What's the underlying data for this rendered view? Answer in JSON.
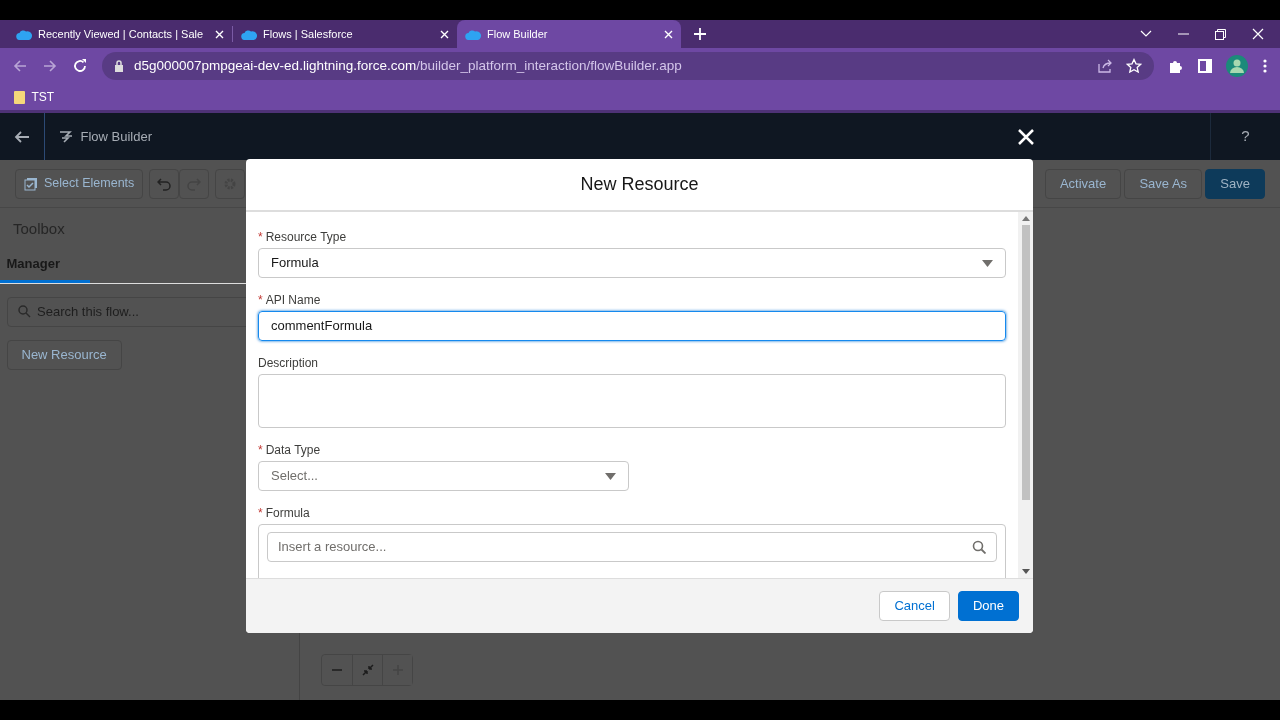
{
  "browser": {
    "tabs": [
      {
        "title": "Recently Viewed | Contacts | Sale",
        "selected": false
      },
      {
        "title": "Flows | Salesforce",
        "selected": false
      },
      {
        "title": "Flow Builder",
        "selected": true
      }
    ],
    "url_host": "d5g000007pmpgeai-dev-ed.lightning.force.com",
    "url_path": "/builder_platform_interaction/flowBuilder.app",
    "bookmarks": [
      {
        "label": "TST"
      }
    ]
  },
  "app": {
    "title": "Flow Builder",
    "help": "?"
  },
  "toolbar": {
    "select_elements": "Select Elements",
    "right_buttons": [
      {
        "label": "Activate",
        "kind": "neutral"
      },
      {
        "label": "Save As",
        "kind": "neutral"
      },
      {
        "label": "Save",
        "kind": "brand"
      }
    ]
  },
  "sidebar": {
    "title": "Toolbox",
    "tabs": [
      {
        "label": "Manager",
        "selected": true
      }
    ],
    "search": {
      "placeholder": "Search this flow..."
    },
    "button": "New Resource"
  },
  "modal": {
    "title": "New Resource",
    "required_mark": "*",
    "fields": [
      {
        "kind": "select",
        "label": "Resource Type",
        "required": true,
        "value": "Formula",
        "focused": false
      },
      {
        "kind": "input",
        "label": "API Name",
        "required": true,
        "value": "commentFormula",
        "focused": true
      },
      {
        "kind": "textarea",
        "label": "Description",
        "required": false,
        "focused": false
      },
      {
        "kind": "select",
        "label": "Data Type",
        "required": true,
        "placeholder": "Select...",
        "focused": false
      },
      {
        "kind": "formula",
        "label": "Formula",
        "required": true,
        "placeholder": "Insert a resource...",
        "focused": false
      }
    ],
    "buttons": [
      {
        "label": "Cancel",
        "kind": "neutral"
      },
      {
        "label": "Done",
        "kind": "brand"
      }
    ]
  }
}
